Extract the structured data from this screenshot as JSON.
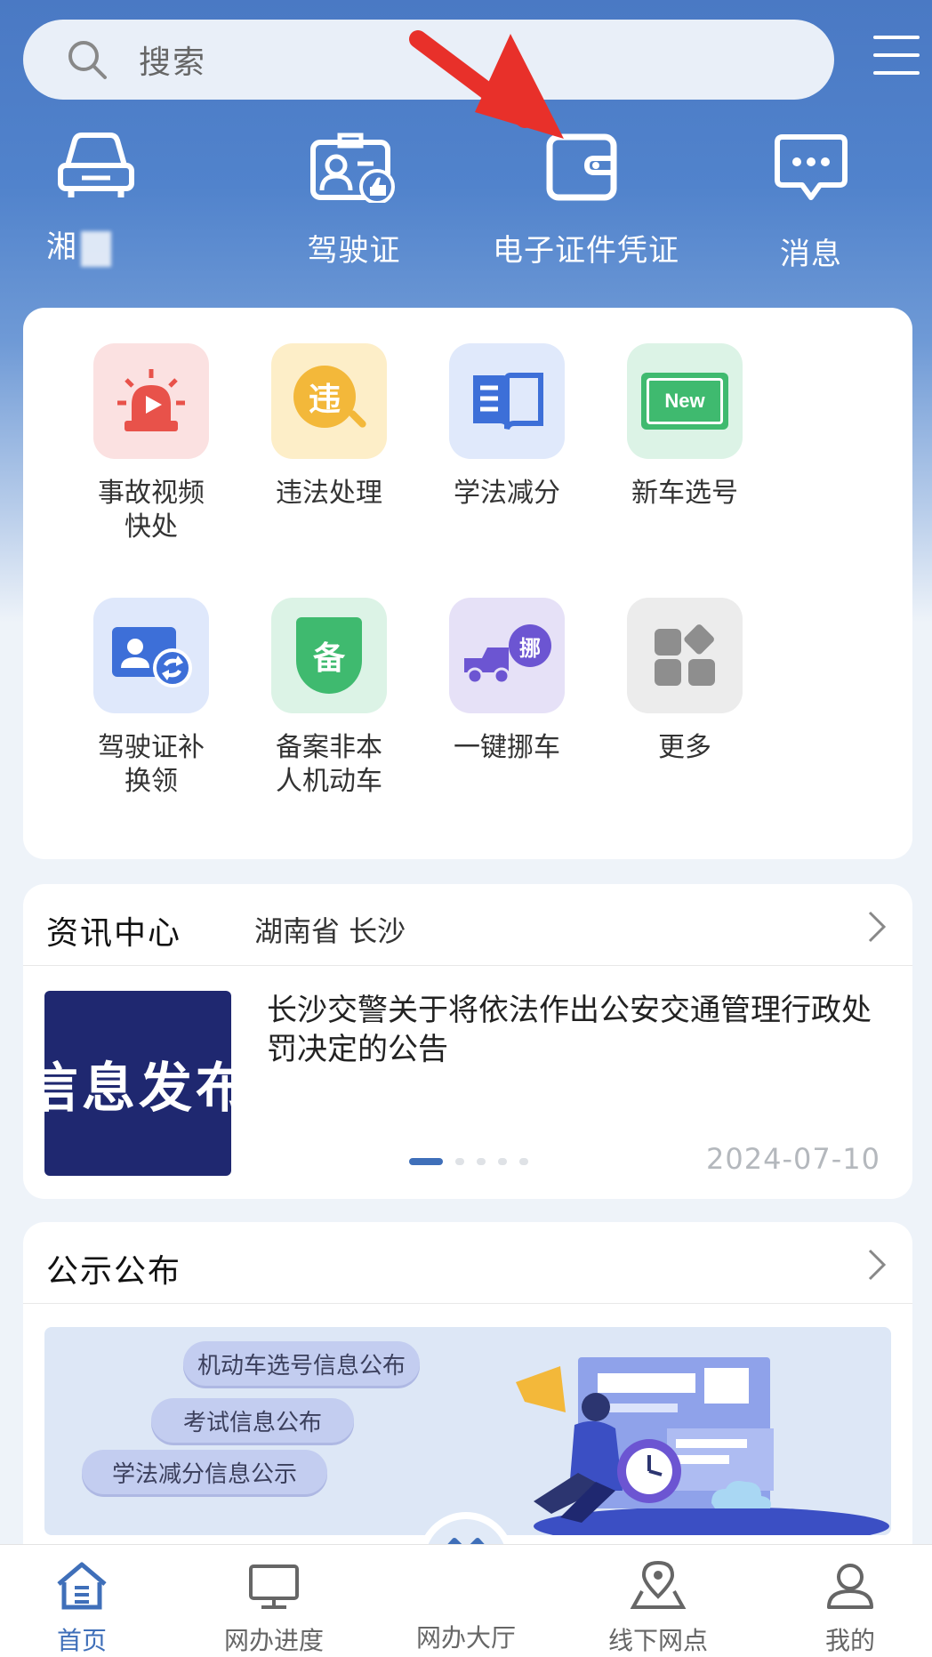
{
  "search": {
    "placeholder": "搜索"
  },
  "shortcuts": [
    {
      "label": "湘",
      "icon": "car-icon"
    },
    {
      "label": "驾驶证",
      "icon": "license-icon"
    },
    {
      "label": "电子证件凭证",
      "icon": "wallet-icon"
    },
    {
      "label": "消息",
      "icon": "message-icon"
    }
  ],
  "services": [
    {
      "label": "事故视频快处",
      "icon": "alarm-video-icon"
    },
    {
      "label": "违法处理",
      "icon": "violation-icon",
      "glyph": "违"
    },
    {
      "label": "学法减分",
      "icon": "book-icon"
    },
    {
      "label": "新车选号",
      "icon": "new-plate-icon",
      "glyph": "New"
    },
    {
      "label": "驾驶证补换领",
      "icon": "license-exchange-icon"
    },
    {
      "label": "备案非本人机动车",
      "icon": "shield-icon",
      "glyph": "备"
    },
    {
      "label": "一键挪车",
      "icon": "tow-truck-icon",
      "glyph": "挪"
    },
    {
      "label": "更多",
      "icon": "grid-icon"
    }
  ],
  "news": {
    "title": "资讯中心",
    "location": "湖南省 长沙",
    "thumb_text": "信息发布",
    "headline": "长沙交警关于将依法作出公安交通管理行政处罚决定的公告",
    "date": "2024-07-10",
    "page_index": 1,
    "page_count": 5
  },
  "announcements": {
    "title": "公示公布",
    "pills": [
      "机动车选号信息公布",
      "考试信息公布",
      "学法减分信息公示"
    ]
  },
  "nav": [
    {
      "label": "首页",
      "icon": "home-icon",
      "active": true
    },
    {
      "label": "网办进度",
      "icon": "monitor-icon",
      "active": false
    },
    {
      "label": "网办大厅",
      "icon": "handshake-icon",
      "active": false
    },
    {
      "label": "线下网点",
      "icon": "map-pin-icon",
      "active": false
    },
    {
      "label": "我的",
      "icon": "user-icon",
      "active": false
    }
  ],
  "colors": {
    "header_blue": "#4a79c4",
    "accent": "#3f6fb9",
    "annotation_arrow": "#e8302a"
  }
}
